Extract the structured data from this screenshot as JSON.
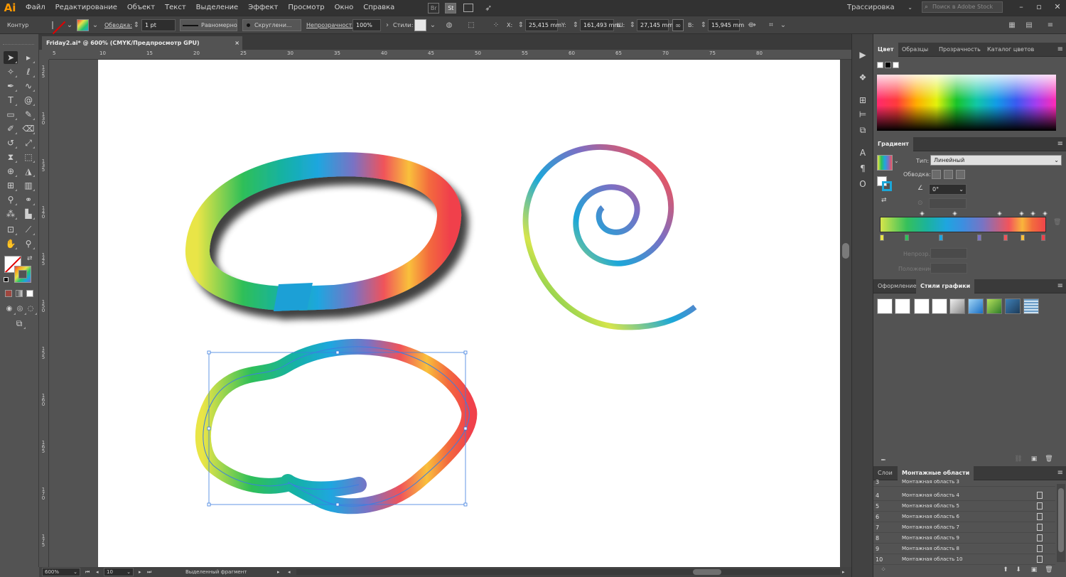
{
  "app": {
    "logo": "Ai"
  },
  "menu": [
    "Файл",
    "Редактирование",
    "Объект",
    "Текст",
    "Выделение",
    "Эффект",
    "Просмотр",
    "Окно",
    "Справка"
  ],
  "menu_icons": {
    "br": "Br",
    "st": "St"
  },
  "workspace": "Трассировка",
  "stock_search_placeholder": "Поиск в Adobe Stock",
  "control": {
    "mode": "Контур",
    "stroke_label": "Обводка:",
    "stroke_weight": "1 pt",
    "profile": "Равномерно",
    "brush": "Скруглени...",
    "opacity_label": "Непрозрачность:",
    "opacity_value": "100%",
    "styles_label": "Стили:",
    "x_label": "X:",
    "x_value": "25,415 mm",
    "y_label": "Y:",
    "y_value": "161,493 mm",
    "w_label": "Ш:",
    "w_value": "27,145 mm",
    "h_label": "В:",
    "h_value": "15,945 mm"
  },
  "document": {
    "tab_title": "Friday2.ai* @ 600% (CMYK/Предпросмотр GPU)",
    "close": "×"
  },
  "ruler_top": [
    "5",
    "10",
    "15",
    "20",
    "25",
    "30",
    "35",
    "40",
    "45",
    "50",
    "55",
    "60",
    "65",
    "70",
    "75",
    "80"
  ],
  "ruler_left": [
    "125",
    "130",
    "135",
    "140",
    "145",
    "150",
    "155",
    "160",
    "165",
    "170",
    "175"
  ],
  "status": {
    "zoom": "600%",
    "artboard_number": "10",
    "selection_text": "Выделенный фрагмент"
  },
  "color_panel": {
    "tabs": [
      "Цвет",
      "Образцы",
      "Прозрачность",
      "Каталог цветов"
    ]
  },
  "gradient_panel": {
    "title": "Градиент",
    "type_label": "Тип:",
    "type_value": "Линейный",
    "stroke_label": "Обводка:",
    "angle_value": "0°",
    "opacity_label": "Непрозр.:",
    "position_label": "Положение:"
  },
  "graphic_styles": {
    "tabs": [
      "Оформление",
      "Стили графики"
    ]
  },
  "artboards_panel": {
    "tabs": [
      "Слои",
      "Монтажные области"
    ],
    "rows": [
      {
        "num": "3",
        "name": "Монтажная область 3"
      },
      {
        "num": "4",
        "name": "Монтажная область 4"
      },
      {
        "num": "5",
        "name": "Монтажная область 5"
      },
      {
        "num": "6",
        "name": "Монтажная область 6"
      },
      {
        "num": "7",
        "name": "Монтажная область 7"
      },
      {
        "num": "8",
        "name": "Монтажная область 9"
      },
      {
        "num": "9",
        "name": "Монтажная область 8"
      },
      {
        "num": "10",
        "name": "Монтажная область 10"
      }
    ]
  },
  "colors": {
    "accent_orange": "#ff9a00",
    "ui_dark": "#323232",
    "ui_mid": "#535353",
    "selection_blue": "#3c7ee0"
  }
}
